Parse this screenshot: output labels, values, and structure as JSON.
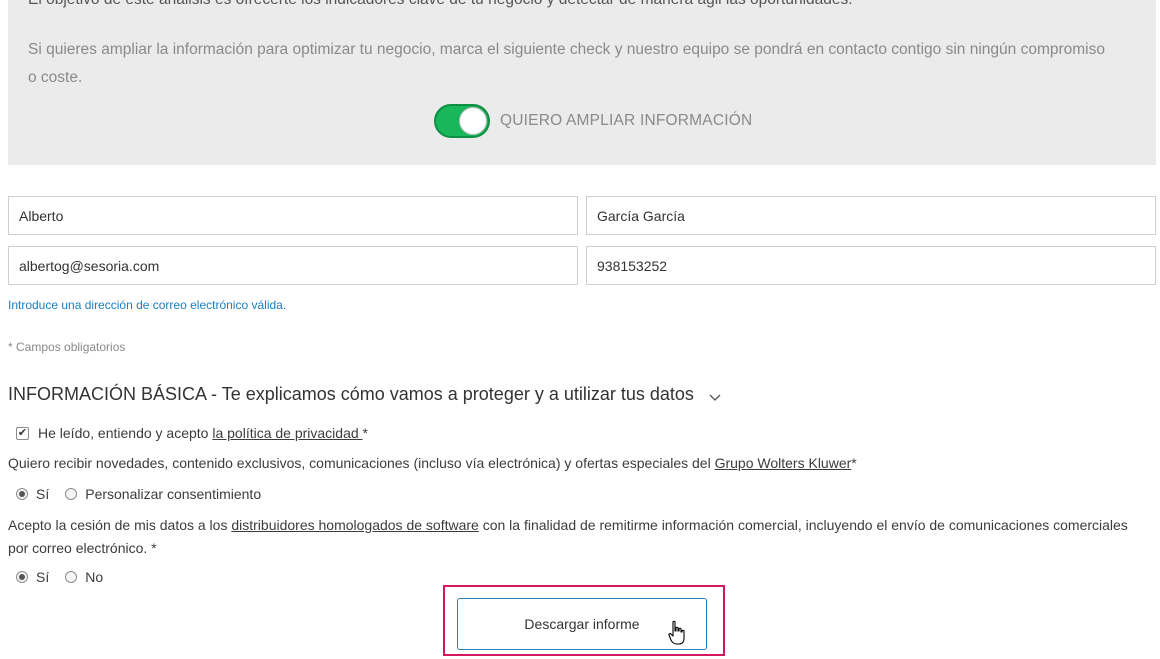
{
  "intro": {
    "objective_text": "El objetivo de este análisis es ofrecerte los indicadores clave de tu negocio y detectar de manera ágil las oportunidades.",
    "expand_text": "Si quieres ampliar la información para optimizar tu negocio, marca el siguiente check y nuestro equipo se pondrá en contacto contigo sin ningún compromiso o coste."
  },
  "toggle": {
    "label": "QUIERO AMPLIAR INFORMACIÓN",
    "on": true,
    "color": "#18b85a"
  },
  "form": {
    "first_name": "Alberto",
    "last_name": "García García",
    "email": "albertog@sesoria.com",
    "phone": "938153252",
    "email_hint": "Introduce una dirección de correo electrónico válida.",
    "required_note": "* Campos obligatorios"
  },
  "basic_info": {
    "title": "INFORMACIÓN BÁSICA - Te explicamos cómo vamos a proteger y a utilizar tus datos",
    "privacy": {
      "checked": true,
      "text_before": "He leído, entiendo y acepto ",
      "link": "la política de privacidad ",
      "text_after": "*"
    },
    "news": {
      "text_before": "Quiero recibir novedades, contenido exclusivos, comunicaciones (incluso vía electrónica) y ofertas especiales del ",
      "link": "Grupo Wolters Kluwer",
      "text_after": "*",
      "options": [
        "Sí",
        "Personalizar consentimiento"
      ],
      "selected": "Sí"
    },
    "cession": {
      "text_before": "Acepto la cesión de mis datos a los ",
      "link": "distribuidores homologados de software",
      "text_after": " con la finalidad de remitirme información comercial, incluyendo el envío de comunicaciones comerciales por correo electrónico. *",
      "options": [
        "Sí",
        "No"
      ],
      "selected": "Sí"
    }
  },
  "download_button": "Descargar informe",
  "colors": {
    "accent": "#2a7fb8",
    "highlight": "#d6175d",
    "hint": "#1a7fc3"
  }
}
